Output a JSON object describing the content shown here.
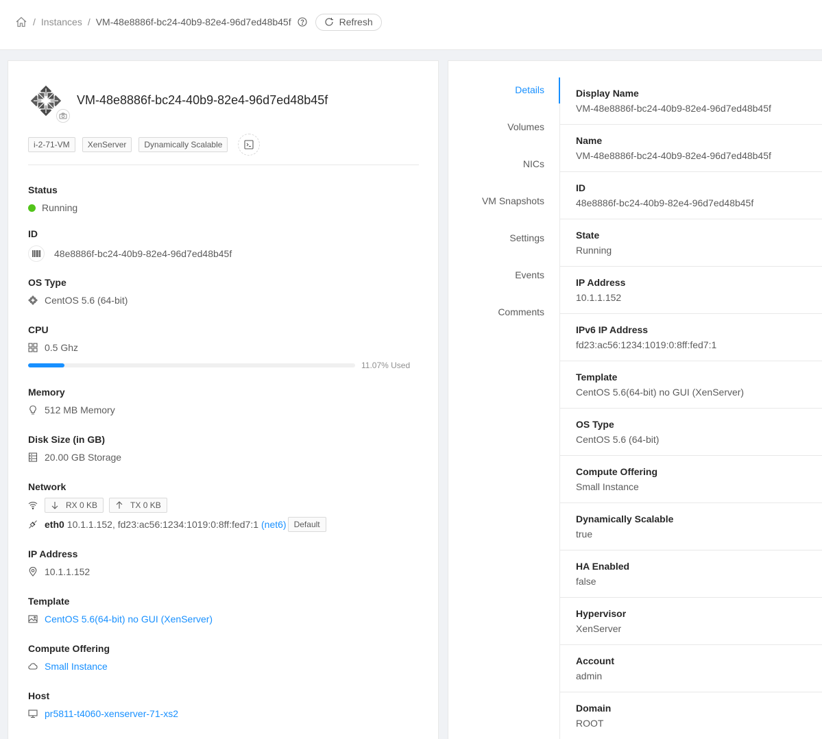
{
  "breadcrumb": {
    "parent": "Instances",
    "current": "VM-48e8886f-bc24-40b9-82e4-96d7ed48b45f",
    "refresh_label": "Refresh"
  },
  "instance": {
    "title": "VM-48e8886f-bc24-40b9-82e4-96d7ed48b45f",
    "tags": [
      "i-2-71-VM",
      "XenServer",
      "Dynamically Scalable"
    ]
  },
  "summary": {
    "status": {
      "label": "Status",
      "value": "Running",
      "color": "#52c41a"
    },
    "id": {
      "label": "ID",
      "value": "48e8886f-bc24-40b9-82e4-96d7ed48b45f"
    },
    "os_type": {
      "label": "OS Type",
      "value": "CentOS 5.6 (64-bit)"
    },
    "cpu": {
      "label": "CPU",
      "value": "0.5 Ghz",
      "used_percent": 11.07,
      "used_text": "11.07% Used"
    },
    "memory": {
      "label": "Memory",
      "value": "512 MB Memory"
    },
    "disk": {
      "label": "Disk Size (in GB)",
      "value": "20.00 GB Storage"
    },
    "network": {
      "label": "Network",
      "rx": "RX 0 KB",
      "tx": "TX 0 KB",
      "nic_name": "eth0",
      "nic_addresses": "10.1.1.152, fd23:ac56:1234:1019:0:8ff:fed7:1",
      "nic_network": "(net6)",
      "nic_default": "Default"
    },
    "ip": {
      "label": "IP Address",
      "value": "10.1.1.152"
    },
    "template": {
      "label": "Template",
      "value": "CentOS 5.6(64-bit) no GUI (XenServer)"
    },
    "compute_offering": {
      "label": "Compute Offering",
      "value": "Small Instance"
    },
    "host": {
      "label": "Host",
      "value": "pr5811-t4060-xenserver-71-xs2"
    }
  },
  "tabs": [
    "Details",
    "Volumes",
    "NICs",
    "VM Snapshots",
    "Settings",
    "Events",
    "Comments"
  ],
  "active_tab": "Details",
  "details": [
    {
      "label": "Display Name",
      "value": "VM-48e8886f-bc24-40b9-82e4-96d7ed48b45f"
    },
    {
      "label": "Name",
      "value": "VM-48e8886f-bc24-40b9-82e4-96d7ed48b45f"
    },
    {
      "label": "ID",
      "value": "48e8886f-bc24-40b9-82e4-96d7ed48b45f"
    },
    {
      "label": "State",
      "value": "Running"
    },
    {
      "label": "IP Address",
      "value": "10.1.1.152"
    },
    {
      "label": "IPv6 IP Address",
      "value": "fd23:ac56:1234:1019:0:8ff:fed7:1"
    },
    {
      "label": "Template",
      "value": "CentOS 5.6(64-bit) no GUI (XenServer)"
    },
    {
      "label": "OS Type",
      "value": "CentOS 5.6 (64-bit)"
    },
    {
      "label": "Compute Offering",
      "value": "Small Instance"
    },
    {
      "label": "Dynamically Scalable",
      "value": "true"
    },
    {
      "label": "HA Enabled",
      "value": "false"
    },
    {
      "label": "Hypervisor",
      "value": "XenServer"
    },
    {
      "label": "Account",
      "value": "admin"
    },
    {
      "label": "Domain",
      "value": "ROOT"
    }
  ],
  "colors": {
    "accent": "#1890ff",
    "running": "#52c41a"
  }
}
